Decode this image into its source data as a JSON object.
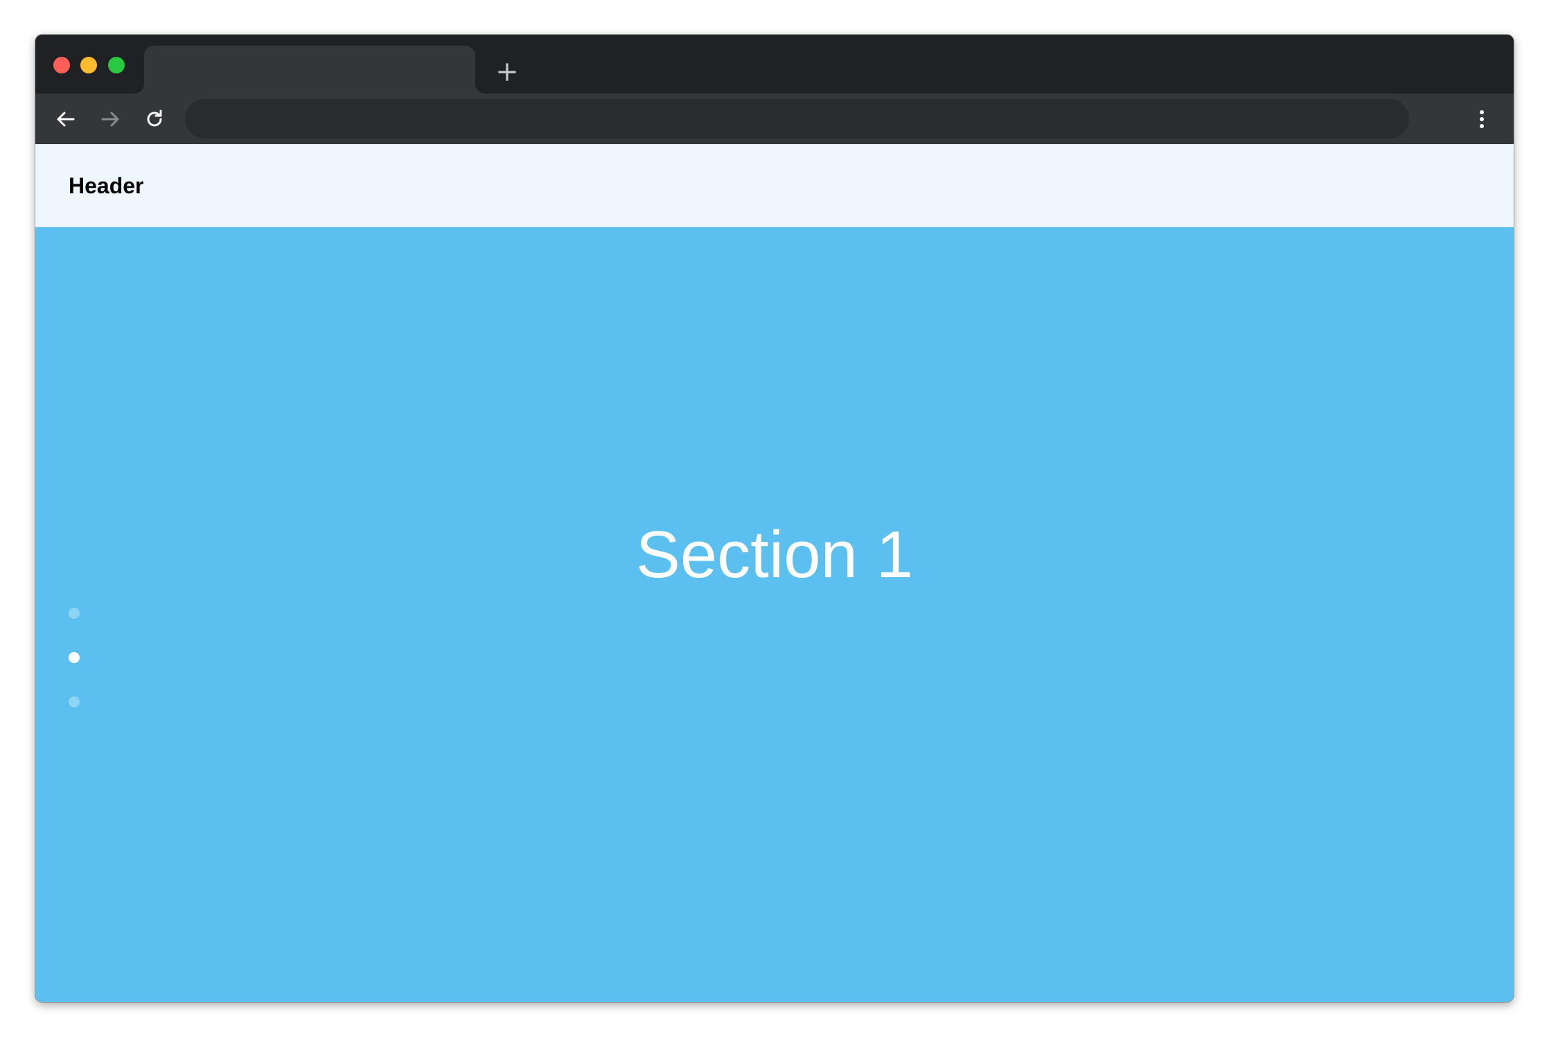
{
  "browser": {
    "tab_title": "",
    "url": "",
    "colors": {
      "close": "#ff5f57",
      "minimize": "#febc2e",
      "maximize": "#28c840",
      "titlebar": "#202124",
      "toolbar": "#35363a"
    },
    "icons": {
      "new_tab": "plus-icon",
      "back": "arrow-left-icon",
      "forward": "arrow-right-icon",
      "reload": "reload-icon",
      "menu": "kebab-menu-icon"
    }
  },
  "page": {
    "header": {
      "title": "Header"
    },
    "section": {
      "title": "Section 1",
      "background": "#5bc0f0"
    },
    "pagination": {
      "count": 3,
      "active_index": 1,
      "active_color": "#ffffff",
      "inactive_color": "#8fd4f5"
    }
  }
}
